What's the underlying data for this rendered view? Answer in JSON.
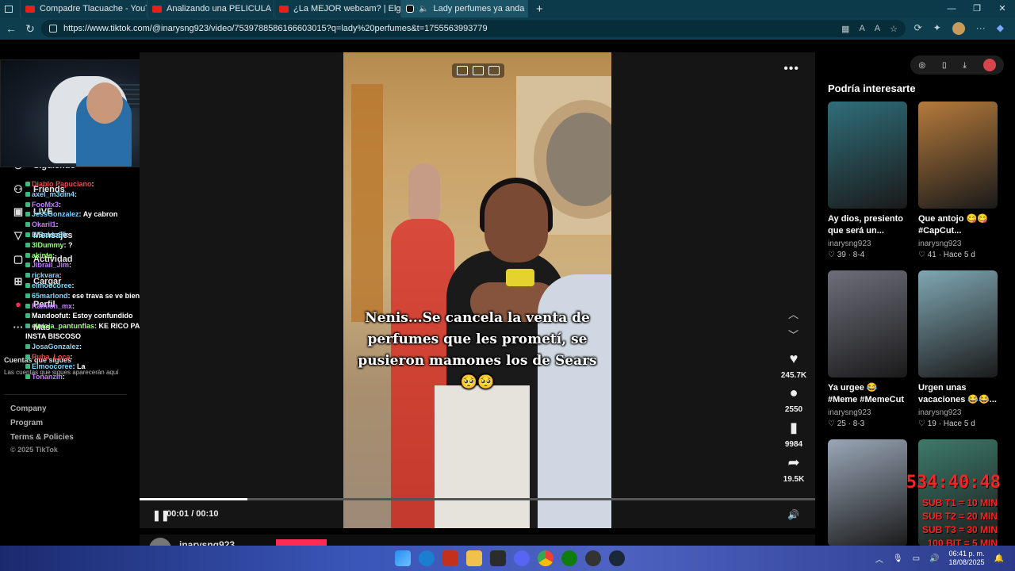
{
  "browser": {
    "tabs": [
      {
        "title": "Compadre Tlacuache - YouTube",
        "kind": "youtube"
      },
      {
        "title": "Analizando una PELICULA HORR",
        "kind": "youtube"
      },
      {
        "title": "¿La MEJOR webcam? | Elgato Fac",
        "kind": "youtube"
      },
      {
        "title": "Lady perfumes ya anda p",
        "kind": "tiktok"
      }
    ],
    "url": "https://www.tiktok.com/@inarysng923/video/7539788586166603015?q=lady%20perfumes&t=1755563993779"
  },
  "sidebar": {
    "items": [
      {
        "label": "Siguiendo",
        "icon": "users-icon"
      },
      {
        "label": "Friends",
        "icon": "friends-icon"
      },
      {
        "label": "LIVE",
        "icon": "live-icon"
      },
      {
        "label": "Mensajes",
        "icon": "messages-icon"
      },
      {
        "label": "Actividad",
        "icon": "activity-icon"
      },
      {
        "label": "Cargar",
        "icon": "upload-icon"
      },
      {
        "label": "Perfil",
        "icon": "profile-icon"
      },
      {
        "label": "Más",
        "icon": "more-icon"
      }
    ],
    "following_heading": "Cuentas que sigues",
    "following_text": "Las cuentas que sigues aparecerán aquí",
    "footer": [
      "Company",
      "Program",
      "Terms & Policies"
    ],
    "copyright": "© 2025 TikTok"
  },
  "chat": [
    {
      "user": "Diablo Papuciano",
      "text": "",
      "color": "#e84a4a"
    },
    {
      "user": "axel_m3din4",
      "text": "",
      "color": "#7fd4ff"
    },
    {
      "user": "FooMx3",
      "text": "",
      "color": "#c77dff"
    },
    {
      "user": "JessGonzalez",
      "text": "Ay cabron",
      "color": "#7fd4ff"
    },
    {
      "user": "Okaril1",
      "text": "",
      "color": "#c77dff"
    },
    {
      "user": "ElBaldo85",
      "text": "",
      "color": "#7fd4ff"
    },
    {
      "user": "3IDummy",
      "text": "?",
      "color": "#9bff7a"
    },
    {
      "user": "akinta",
      "text": "",
      "color": "#9bff7a"
    },
    {
      "user": "Jibrail_Jim",
      "text": "",
      "color": "#c77dff"
    },
    {
      "user": "rickvara",
      "text": "",
      "color": "#7fd4ff"
    },
    {
      "user": "elmoocoree",
      "text": "",
      "color": "#7fd4ff"
    },
    {
      "user": "65marlond",
      "text": "ese trava se ve bien",
      "color": "#7fd4ff"
    },
    {
      "user": "Ramion_mx",
      "text": "",
      "color": "#c77dff"
    },
    {
      "user": "Mandoofut",
      "text": "Estoy confundido",
      "color": "#ffffff"
    },
    {
      "user": "elmoja_pantunflas",
      "text": "KE RICO PASA SU INSTA BISCOSO",
      "color": "#9bff7a"
    },
    {
      "user": "JosaGonzalez",
      "text": "",
      "color": "#7fd4ff"
    },
    {
      "user": "Ruba_Loca",
      "text": "",
      "color": "#e84a4a"
    },
    {
      "user": "Elmoocoree",
      "text": "La",
      "color": "#7fd4ff"
    },
    {
      "user": "Tonanzin",
      "text": "",
      "color": "#c77dff"
    }
  ],
  "video": {
    "caption_lines": [
      "Nenis...Se cancela la venta de",
      "perfumes que les prometí, se",
      "pusieron mamones los de Sears",
      "🥺🥺"
    ],
    "likes": "245.7K",
    "comments": "2550",
    "saves": "9984",
    "shares": "19.5K",
    "time": "00:01 / 00:10",
    "progress_fraction": 0.16,
    "author": "inarysng923"
  },
  "recommended": {
    "heading": "Podría interesarte",
    "cards": [
      {
        "title": "Ay dios, presiento que será un...",
        "author": "inarysng923",
        "meta": "♡ 39 · 8-4",
        "thumb_color": "#2f6e7a"
      },
      {
        "title": "Que antojo 😋😋 #CapCut...",
        "author": "inarysng923",
        "meta": "♡ 41 · Hace 5 d",
        "thumb_color": "#b57a3c"
      },
      {
        "title": "Ya urgee 😂 #Meme #MemeCut #CapC...",
        "author": "inarysng923",
        "meta": "♡ 25 · 8-3",
        "thumb_color": "#6d6e7a"
      },
      {
        "title": "Urgen unas vacaciones 😂😂...",
        "author": "inarysng923",
        "meta": "♡ 19 · Hace 5 d",
        "thumb_color": "#7fa7b3"
      },
      {
        "title": "",
        "author": "",
        "meta": "",
        "thumb_color": "#9aa7b8"
      },
      {
        "title": "",
        "author": "",
        "meta": "",
        "thumb_color": "#3d7a6a"
      }
    ]
  },
  "stream_overlay": {
    "timer": "534:40:48",
    "lines": [
      "SUB T1 = 10 MIN",
      "SUB T2 = 20 MIN",
      "SUB T3 = 30 MIN",
      "100 BIT = 5 MIN"
    ]
  },
  "taskbar": {
    "time": "06:41 p. m.",
    "date": "18/08/2025"
  }
}
